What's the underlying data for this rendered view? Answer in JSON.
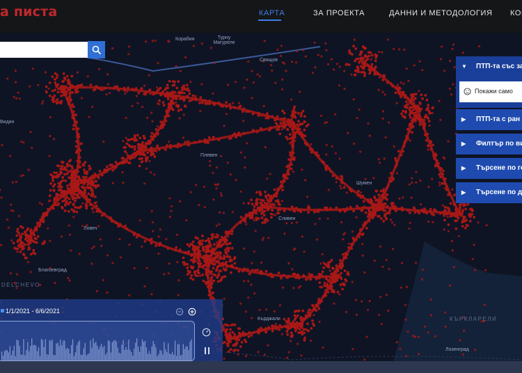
{
  "header": {
    "logo_text": "а писта",
    "nav": [
      {
        "label": "КАРТА",
        "active": true
      },
      {
        "label": "ЗА ПРОЕКТА",
        "active": false
      },
      {
        "label": "ДАННИ И МЕТОДОЛОГИЯ",
        "active": false
      },
      {
        "label": "КОН",
        "active": false
      }
    ]
  },
  "search": {
    "value": "",
    "placeholder": ""
  },
  "filters": {
    "items": [
      {
        "label": "ПТП-та със за",
        "open": true
      },
      {
        "label": "ПТП-та с ран",
        "open": false
      },
      {
        "label": "Филтър по ви",
        "open": false
      },
      {
        "label": "Търсене по го",
        "open": false
      },
      {
        "label": "Търсене по да",
        "open": false
      }
    ],
    "checkbox_label": "Покажи само"
  },
  "map": {
    "cities": [
      {
        "name": "Корабия"
      },
      {
        "name": "Турну Магуреле"
      },
      {
        "name": "Свищов"
      },
      {
        "name": "Видин"
      },
      {
        "name": "Плевен"
      },
      {
        "name": "Ловеч"
      },
      {
        "name": "Сливен"
      },
      {
        "name": "Шумен"
      },
      {
        "name": "Благоевград"
      },
      {
        "name": "Кърджали"
      },
      {
        "name": "Лозенград"
      }
    ],
    "regions": [
      "DELCHEVO",
      "КЪРКЛАРЕЛИ"
    ],
    "colors": {
      "accident": "#a81816",
      "water": "#1a2a4a",
      "land": "#0e1424"
    }
  },
  "timeline": {
    "date_range": "1/1/2021 - 6/6/2021"
  }
}
